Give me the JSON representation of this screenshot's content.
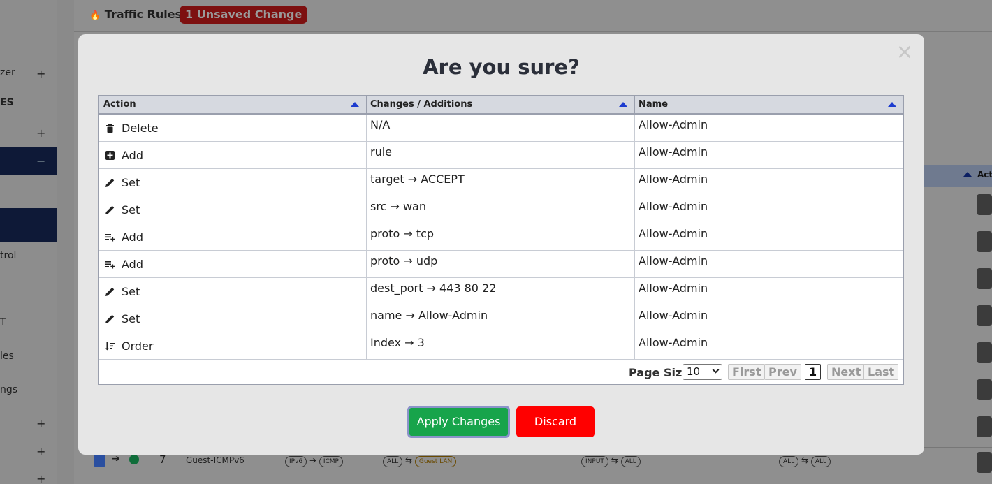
{
  "background": {
    "page_title": "Traffic Rules",
    "unsaved_badge": "1 Unsaved Change",
    "sidebar_fragments": [
      "zer",
      "ES",
      "trol",
      "T",
      "les",
      "ngs"
    ],
    "bottom_row": {
      "index": "7",
      "name": "Guest-ICMPv6",
      "proto_from": "IPv6",
      "proto_to": "ICMP",
      "src_any": "ALL",
      "src_zone": "Guest LAN",
      "chain": "INPUT",
      "dst_any": "ALL",
      "act_from": "ALL",
      "act_to": "ALL"
    },
    "col_fragment": "Act"
  },
  "modal": {
    "title": "Are you sure?",
    "columns": [
      "Action",
      "Changes / Additions",
      "Name"
    ],
    "rows": [
      {
        "icon": "trash-icon",
        "action": "Delete",
        "change": "N/A",
        "name": "Allow-Admin"
      },
      {
        "icon": "plus-square-icon",
        "action": "Add",
        "change": "rule",
        "name": "Allow-Admin"
      },
      {
        "icon": "pencil-icon",
        "action": "Set",
        "change": "target → ACCEPT",
        "name": "Allow-Admin"
      },
      {
        "icon": "pencil-icon",
        "action": "Set",
        "change": "src → wan",
        "name": "Allow-Admin"
      },
      {
        "icon": "list-add-icon",
        "action": "Add",
        "change": "proto → tcp",
        "name": "Allow-Admin"
      },
      {
        "icon": "list-add-icon",
        "action": "Add",
        "change": "proto → udp",
        "name": "Allow-Admin"
      },
      {
        "icon": "pencil-icon",
        "action": "Set",
        "change": "dest_port → 443 80 22",
        "name": "Allow-Admin"
      },
      {
        "icon": "pencil-icon",
        "action": "Set",
        "change": "name → Allow-Admin",
        "name": "Allow-Admin"
      },
      {
        "icon": "sort-order-icon",
        "action": "Order",
        "change": "Index → 3",
        "name": "Allow-Admin"
      }
    ],
    "pager": {
      "page_size_label": "Page Size",
      "page_size_value": "10",
      "first": "First",
      "prev": "Prev",
      "current_page": "1",
      "next": "Next",
      "last": "Last"
    },
    "apply_label": "Apply Changes",
    "discard_label": "Discard",
    "close_glyph": "×"
  }
}
